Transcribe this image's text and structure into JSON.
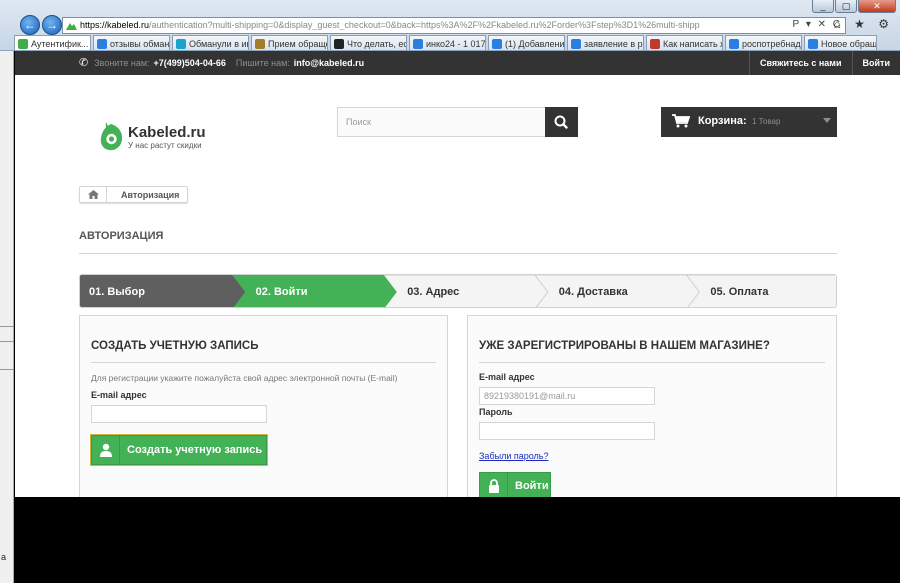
{
  "browser": {
    "url_host": "https://kabeled.ru",
    "url_path": "/authentication?multi-shipping=0&display_guest_checkout=0&back=https%3A%2F%2Fkabeled.ru%2Forder%3Fstep%3D1%26multi-shipping%3D0",
    "window_buttons": {
      "minimize": "_",
      "maximize": "▢",
      "close": "✕"
    },
    "nav": {
      "back": "←",
      "forward": "→"
    },
    "address_tools": "P ▾ ✕ C",
    "chrome_icons": "⌂ ★ ⚙",
    "tabs": [
      {
        "label": "Аутентифик...",
        "active": true,
        "color": "#3fae49",
        "closable": true
      },
      {
        "label": "отзывы обман...",
        "active": false,
        "color": "#2c7de0"
      },
      {
        "label": "Обманули в ин...",
        "active": false,
        "color": "#1aa3c9"
      },
      {
        "label": "Прием обраще...",
        "active": false,
        "color": "#a27b2c"
      },
      {
        "label": "Что делать, есл...",
        "active": false,
        "color": "#222222"
      },
      {
        "label": "инко24 - 1 017 ...",
        "active": false,
        "color": "#2c7de0"
      },
      {
        "label": "(1) Добавление...",
        "active": false,
        "color": "#2c7de0"
      },
      {
        "label": "заявление в ро...",
        "active": false,
        "color": "#2c7de0"
      },
      {
        "label": "Как написать ж...",
        "active": false,
        "color": "#c0392b"
      },
      {
        "label": "роспотребнадз...",
        "active": false,
        "color": "#2c7de0"
      },
      {
        "label": "Новое обраще...",
        "active": false,
        "color": "#2c7de0"
      }
    ]
  },
  "side_window": {
    "tag": "а"
  },
  "header": {
    "call_label": "Звоните нам:",
    "phone": "+7(499)504-04-66",
    "write_label": "Пишите нам:",
    "email": "info@kabeled.ru",
    "links": [
      "Свяжитесь с нами",
      "Войти"
    ]
  },
  "logo": {
    "name": "Kabeled.ru",
    "slogan": "У нас растут скидки"
  },
  "search": {
    "placeholder": "Поиск"
  },
  "cart": {
    "label": "Корзина:",
    "qty": "1 Товар"
  },
  "breadcrumb": {
    "current": "Авторизация"
  },
  "page_title": "АВТОРИЗАЦИЯ",
  "steps": [
    {
      "label": "01. Выбор",
      "state": "done"
    },
    {
      "label": "02. Войти",
      "state": "current"
    },
    {
      "label": "03. Адрес",
      "state": "todo"
    },
    {
      "label": "04. Доставка",
      "state": "todo"
    },
    {
      "label": "05. Оплата",
      "state": "todo"
    }
  ],
  "create_account": {
    "heading": "СОЗДАТЬ УЧЕТНУЮ ЗАПИСЬ",
    "description": "Для регистрации укажите пожалуйста свой адрес электронной почты (E-mail)",
    "email_label": "E-mail адрес",
    "email_value": "",
    "button": "Создать учетную запись"
  },
  "login": {
    "heading": "УЖЕ ЗАРЕГИСТРИРОВАНЫ В НАШЕМ МАГАЗИНЕ?",
    "email_label": "E-mail адрес",
    "email_value": "89219380191@mail.ru",
    "password_label": "Пароль",
    "password_value": "",
    "forgot": "Забыли пароль?",
    "button": "Войти"
  },
  "colors": {
    "accent_green": "#43b155",
    "dark": "#333333",
    "step_done": "#5f5f5f",
    "link": "#1b2ac6"
  }
}
